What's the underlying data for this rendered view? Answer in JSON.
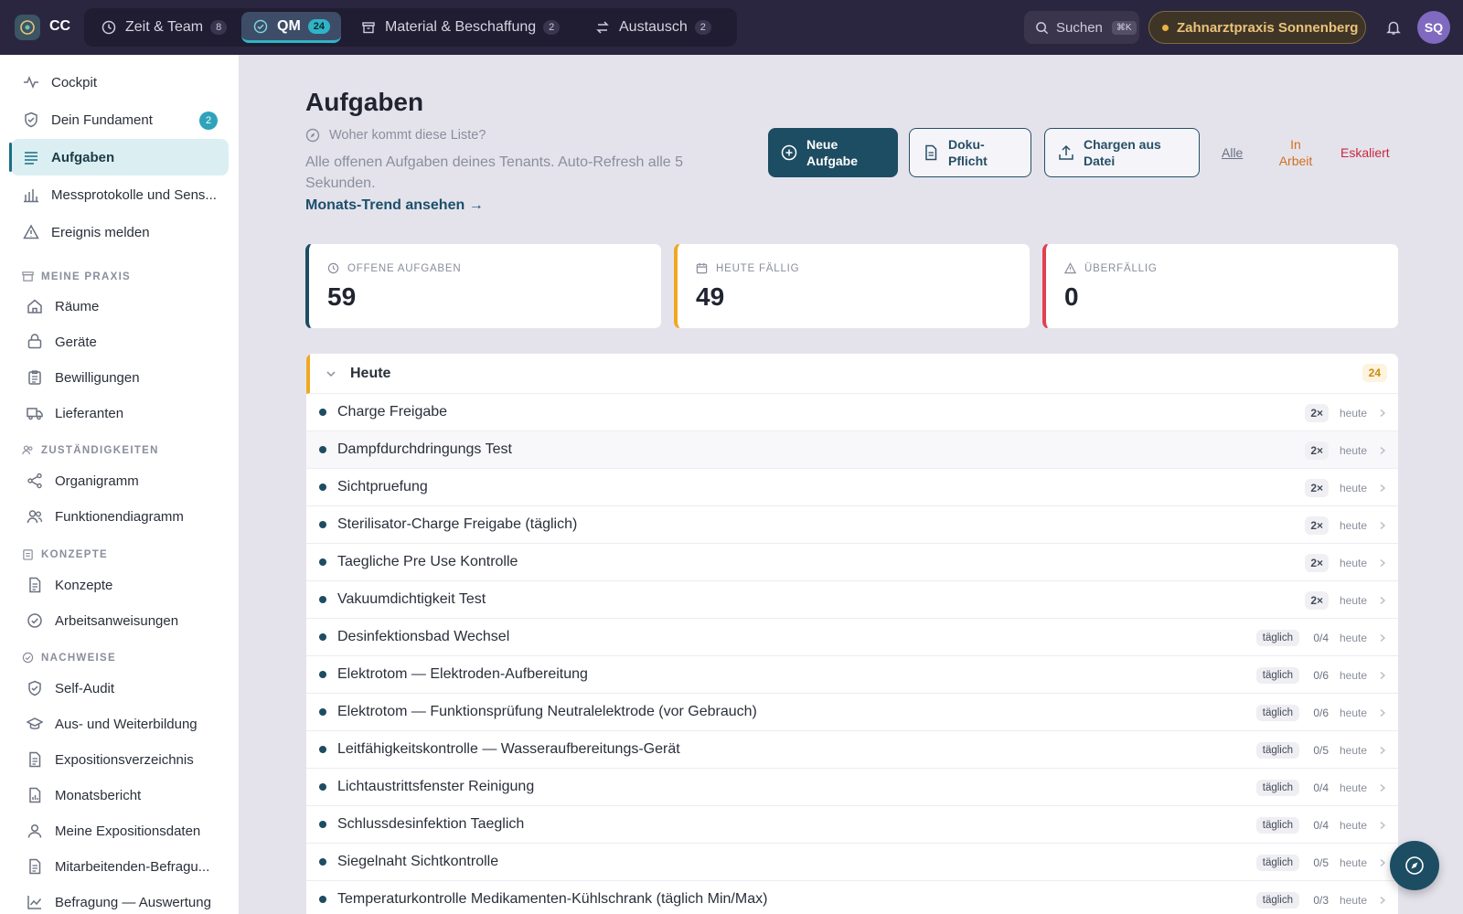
{
  "app": {
    "logo_text": "CC"
  },
  "tabs": [
    {
      "label": "Zeit & Team",
      "count": "8",
      "icon": "clock-icon"
    },
    {
      "label": "QM",
      "count": "24",
      "icon": "check-circle-icon",
      "active": true
    },
    {
      "label": "Material & Beschaffung",
      "count": "2",
      "icon": "box-icon"
    },
    {
      "label": "Austausch",
      "count": "2",
      "icon": "arrows-icon"
    }
  ],
  "header": {
    "search_label": "Suchen",
    "search_shortcut": "⌘K",
    "tenant": "Zahnarztpraxis Sonnenberg",
    "avatar": "SQ"
  },
  "sidebar": {
    "items": [
      {
        "label": "Cockpit",
        "icon": "pulse-icon"
      },
      {
        "label": "Dein Fundament",
        "icon": "shield-icon",
        "badge": "2"
      },
      {
        "label": "Aufgaben",
        "icon": "list-icon",
        "active": true
      },
      {
        "label": "Messprotokolle und Sens...",
        "icon": "bar-chart-icon"
      },
      {
        "label": "Ereignis melden",
        "icon": "warning-icon"
      }
    ],
    "sections": [
      {
        "title": "MEINE PRAXIS",
        "icon": "archive-icon",
        "items": [
          {
            "label": "Räume",
            "icon": "home-icon"
          },
          {
            "label": "Geräte",
            "icon": "device-icon"
          },
          {
            "label": "Bewilligungen",
            "icon": "clipboard-icon"
          },
          {
            "label": "Lieferanten",
            "icon": "truck-icon"
          }
        ]
      },
      {
        "title": "ZUSTÄNDIGKEITEN",
        "icon": "users-icon",
        "items": [
          {
            "label": "Organigramm",
            "icon": "share-icon"
          },
          {
            "label": "Funktionendiagramm",
            "icon": "users-icon"
          }
        ]
      },
      {
        "title": "KONZEPTE",
        "icon": "clipboard-icon",
        "items": [
          {
            "label": "Konzepte",
            "icon": "document-icon"
          },
          {
            "label": "Arbeitsanweisungen",
            "icon": "check-circle-icon"
          }
        ]
      },
      {
        "title": "NACHWEISE",
        "icon": "check-circle-icon",
        "items": [
          {
            "label": "Self-Audit",
            "icon": "shield-icon"
          },
          {
            "label": "Aus- und Weiterbildung",
            "icon": "graduation-icon"
          },
          {
            "label": "Expositionsverzeichnis",
            "icon": "document-icon"
          },
          {
            "label": "Monatsbericht",
            "icon": "report-icon"
          },
          {
            "label": "Meine Expositionsdaten",
            "icon": "user-icon"
          },
          {
            "label": "Mitarbeitenden-Befragu...",
            "icon": "document-icon"
          },
          {
            "label": "Befragung — Auswertung",
            "icon": "chart-line-icon"
          }
        ]
      }
    ]
  },
  "main": {
    "title": "Aufgaben",
    "origin": "Woher kommt diese Liste?",
    "description": "Alle offenen Aufgaben deines Tenants. Auto-Refresh alle 5 Sekunden.",
    "trend_link": "Monats-Trend ansehen →",
    "buttons": {
      "new_task": "Neue Aufgabe",
      "docu": "Doku-Pflicht",
      "import": "Chargen aus Datei"
    },
    "filters": {
      "all": "Alle",
      "in_progress": "In Arbeit",
      "escalated": "Eskaliert"
    },
    "kpis": [
      {
        "label": "OFFENE AUFGABEN",
        "value": "59",
        "color": "#1d4d62",
        "icon": "clock-icon"
      },
      {
        "label": "HEUTE FÄLLIG",
        "value": "49",
        "color": "#f0a821",
        "icon": "calendar-icon"
      },
      {
        "label": "ÜBERFÄLLIG",
        "value": "0",
        "color": "#e0414f",
        "icon": "warning-icon"
      }
    ],
    "group": {
      "title": "Heute",
      "count": "24",
      "rows": [
        {
          "title": "Charge Freigabe",
          "tag": "2×",
          "due": "heute"
        },
        {
          "title": "Dampfdurchdringungs Test",
          "tag": "2×",
          "due": "heute"
        },
        {
          "title": "Sichtpruefung",
          "tag": "2×",
          "due": "heute"
        },
        {
          "title": "Sterilisator-Charge Freigabe (täglich)",
          "tag": "2×",
          "due": "heute"
        },
        {
          "title": "Taegliche Pre Use Kontrolle",
          "tag": "2×",
          "due": "heute"
        },
        {
          "title": "Vakuumdichtigkeit Test",
          "tag": "2×",
          "due": "heute"
        },
        {
          "title": "Desinfektionsbad Wechsel",
          "freq": "täglich",
          "progress": "0/4",
          "due": "heute"
        },
        {
          "title": "Elektrotom — Elektroden-Aufbereitung",
          "freq": "täglich",
          "progress": "0/6",
          "due": "heute"
        },
        {
          "title": "Elektrotom — Funktionsprüfung Neutralelektrode (vor Gebrauch)",
          "freq": "täglich",
          "progress": "0/6",
          "due": "heute"
        },
        {
          "title": "Leitfähigkeitskontrolle — Wasseraufbereitungs-Gerät",
          "freq": "täglich",
          "progress": "0/5",
          "due": "heute"
        },
        {
          "title": "Lichtaustrittsfenster Reinigung",
          "freq": "täglich",
          "progress": "0/4",
          "due": "heute"
        },
        {
          "title": "Schlussdesinfektion Taeglich",
          "freq": "täglich",
          "progress": "0/4",
          "due": "heute"
        },
        {
          "title": "Siegelnaht Sichtkontrolle",
          "freq": "täglich",
          "progress": "0/5",
          "due": "heute"
        },
        {
          "title": "Temperaturkontrolle Medikamenten-Kühlschrank (täglich Min/Max)",
          "freq": "täglich",
          "progress": "0/3",
          "due": "heute"
        }
      ]
    }
  },
  "colors": {
    "accent": "#1d4d62",
    "teal": "#2fb4c7",
    "warning": "#f0a821",
    "danger": "#e0414f"
  }
}
